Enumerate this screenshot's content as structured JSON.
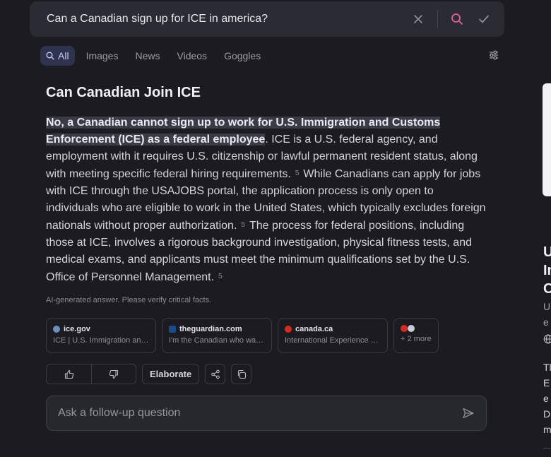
{
  "search": {
    "query": "Can a Canadian sign up for ICE in america?"
  },
  "tabs": [
    {
      "label": "All"
    },
    {
      "label": "Images"
    },
    {
      "label": "News"
    },
    {
      "label": "Videos"
    },
    {
      "label": "Goggles"
    }
  ],
  "answer": {
    "title": "Can Canadian Join ICE",
    "highlight": "No, a Canadian cannot sign up to work for U.S. Immigration and Customs Enforcement (ICE) as a federal employee",
    "p1": ". ICE is a U.S. federal agency, and employment with it requires U.S. citizenship or lawful permanent resident status, along with meeting specific federal hiring requirements.",
    "c1": "5",
    "p2": "While Canadians can apply for jobs with ICE through the USAJOBS portal, the application process is only open to individuals who are eligible to work in the United States, which typically excludes foreign nationals without proper authorization.",
    "c2": "5",
    "p3": "The process for federal positions, including those at ICE, involves a rigorous background investigation, physical fitness tests, and medical exams, and applicants must meet the minimum qualifications set by the U.S. Office of Personnel Management.",
    "c3": "5",
    "disclaimer": "AI-generated answer. Please verify critical facts."
  },
  "sources": [
    {
      "domain": "ice.gov",
      "snippet": "ICE | U.S. Immigration and Customs Enforcement",
      "color": "#6b8fb8"
    },
    {
      "domain": "theguardian.com",
      "snippet": "I'm the Canadian who was detained by ICE",
      "color": "#1a4b8c"
    },
    {
      "domain": "canada.ca",
      "snippet": "International Experience Canada",
      "color": "#d52b1e"
    }
  ],
  "more_sources": "+ 2 more",
  "actions": {
    "elaborate": "Elaborate"
  },
  "followup": {
    "placeholder": "Ask a follow-up question"
  },
  "side": {
    "l1": "U",
    "l2": "In",
    "l3": "C",
    "s1": "U",
    "s2": "e",
    "t1": "Tl",
    "t2": "E",
    "t3": "e",
    "t4": "D",
    "t5": "m"
  },
  "colors": {
    "accent": "#c8cdf5",
    "search_icon": "#e0609a",
    "background": "#1b1b21"
  }
}
